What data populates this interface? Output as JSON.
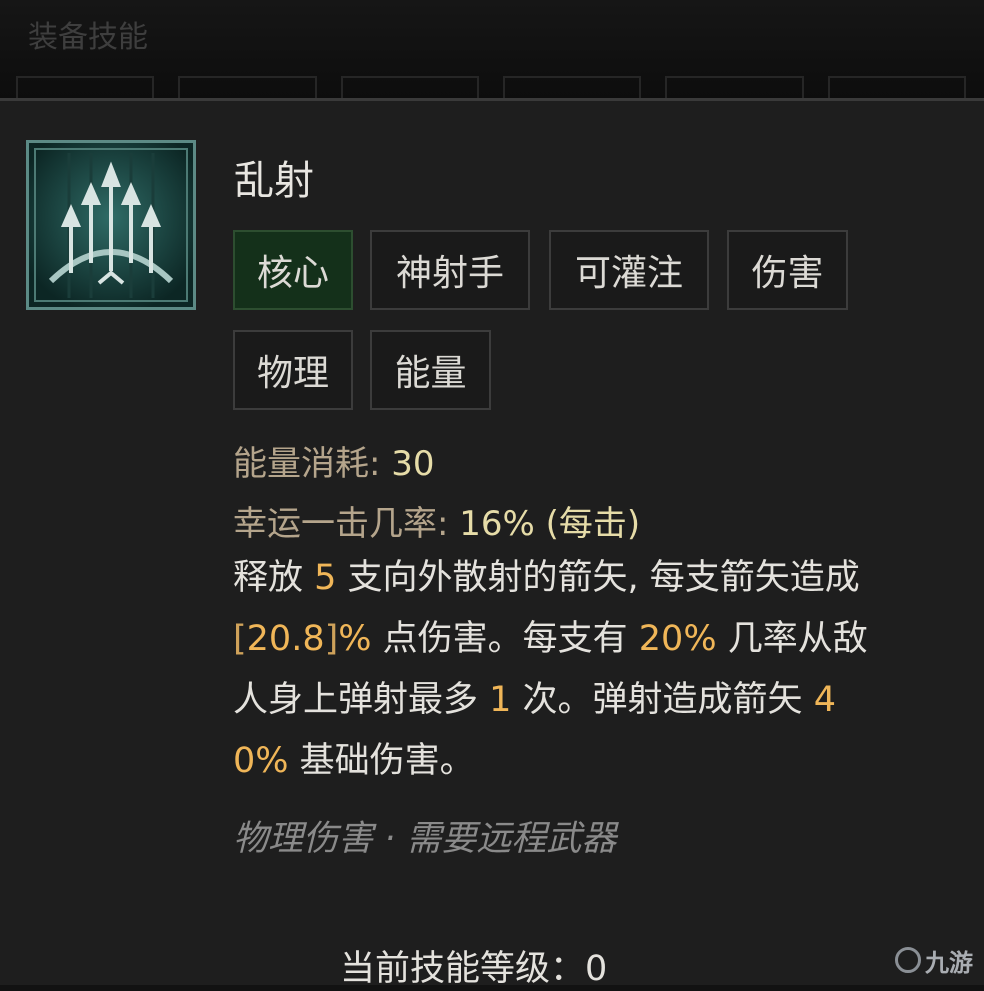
{
  "header": {
    "title": "装备技能"
  },
  "skill": {
    "name": "乱射",
    "icon": "arrow-volley-icon",
    "tags": [
      "核心",
      "神射手",
      "可灌注",
      "伤害",
      "物理",
      "能量"
    ],
    "stats": {
      "cost_label": "能量消耗: ",
      "cost_value": "30",
      "lucky_label": "幸运一击几率: ",
      "lucky_value": "16%",
      "lucky_suffix": " (每击)"
    },
    "description": {
      "l1_a": "释放 ",
      "l1_n1": "5",
      "l1_b": " 支向外散射的箭矢, 每支箭矢造成",
      "l2_open": "[",
      "l2_n1": "20.8",
      "l2_close": "]",
      "l2_pct": "%",
      "l2_a": " 点伤害。每支有 ",
      "l2_n2": "20%",
      "l2_b": " 几率从敌",
      "l3_a": "人身上弹射最多 ",
      "l3_n1": "1",
      "l3_b": " 次。弹射造成箭矢 ",
      "l3_n2": "4",
      "l4_n1": "0%",
      "l4_a": " 基础伤害。"
    },
    "requirements": "物理伤害 · 需要远程武器",
    "level_label": "当前技能等级：",
    "level_value": "0"
  },
  "watermark": {
    "text": "九游"
  },
  "colors": {
    "tag_primary_bg": "#14301a",
    "highlight": "#f0b658",
    "stat_label": "#b5a58c"
  }
}
